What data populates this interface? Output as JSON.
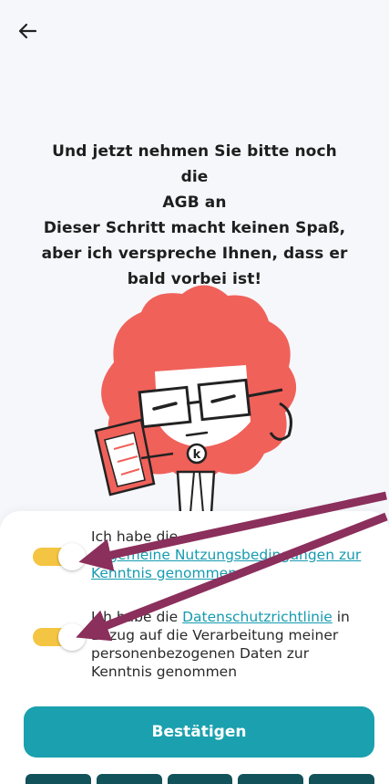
{
  "header": {
    "back_icon": "arrow-left-icon"
  },
  "headline": {
    "line1": "Und jetzt nehmen Sie bitte noch die",
    "line2": "AGB an",
    "line3": "Dieser Schritt macht keinen Spaß,",
    "line4": "aber ich verspreche Ihnen, dass er",
    "line5": "bald vorbei ist!"
  },
  "consent_terms": {
    "text_before": "Ich habe die",
    "link": "Allgemeine Nutzungsbedingungen zur Kenntnis genommen",
    "toggle_on": true
  },
  "consent_privacy": {
    "text_before": "Ich habe die",
    "link": "Datenschutzrichtlinie",
    "text_after": "in Bezug auf die Verarbeitung meiner personenbezogenen Daten zur Kenntnis genommen",
    "toggle_on": true
  },
  "confirm_label": "Bestätigen",
  "colors": {
    "accent": "#1aa0ae",
    "link": "#159bb0",
    "toggle": "#f4c542",
    "mascot": "#f0615a",
    "annotation_arrow": "#8b2f5c"
  }
}
